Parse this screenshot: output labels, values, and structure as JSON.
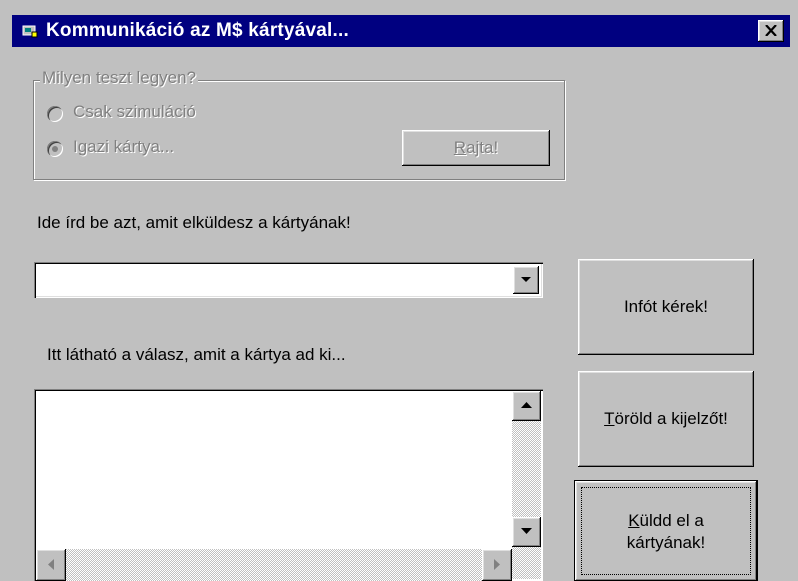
{
  "window": {
    "title": "Kommunikáció az M$ kártyával..."
  },
  "test_group": {
    "legend": "Milyen teszt legyen?",
    "options": [
      {
        "label": "Csak szimuláció",
        "selected": false
      },
      {
        "label": "Igazi kártya...",
        "selected": true
      }
    ],
    "start_button": {
      "accel": "R",
      "rest": "ajta!"
    }
  },
  "send": {
    "label": "Ide írd be azt, amit elküldesz a kártyának!",
    "value": ""
  },
  "response": {
    "label": "Itt látható a válasz, amit a kártya ad ki...",
    "value": ""
  },
  "buttons": {
    "info": "Infót kérek!",
    "clear": {
      "accel": "T",
      "rest": "öröld a kijelzőt!"
    },
    "send": {
      "accel": "K",
      "line1_rest": "üldd el a",
      "line2": "kártyának!"
    }
  }
}
